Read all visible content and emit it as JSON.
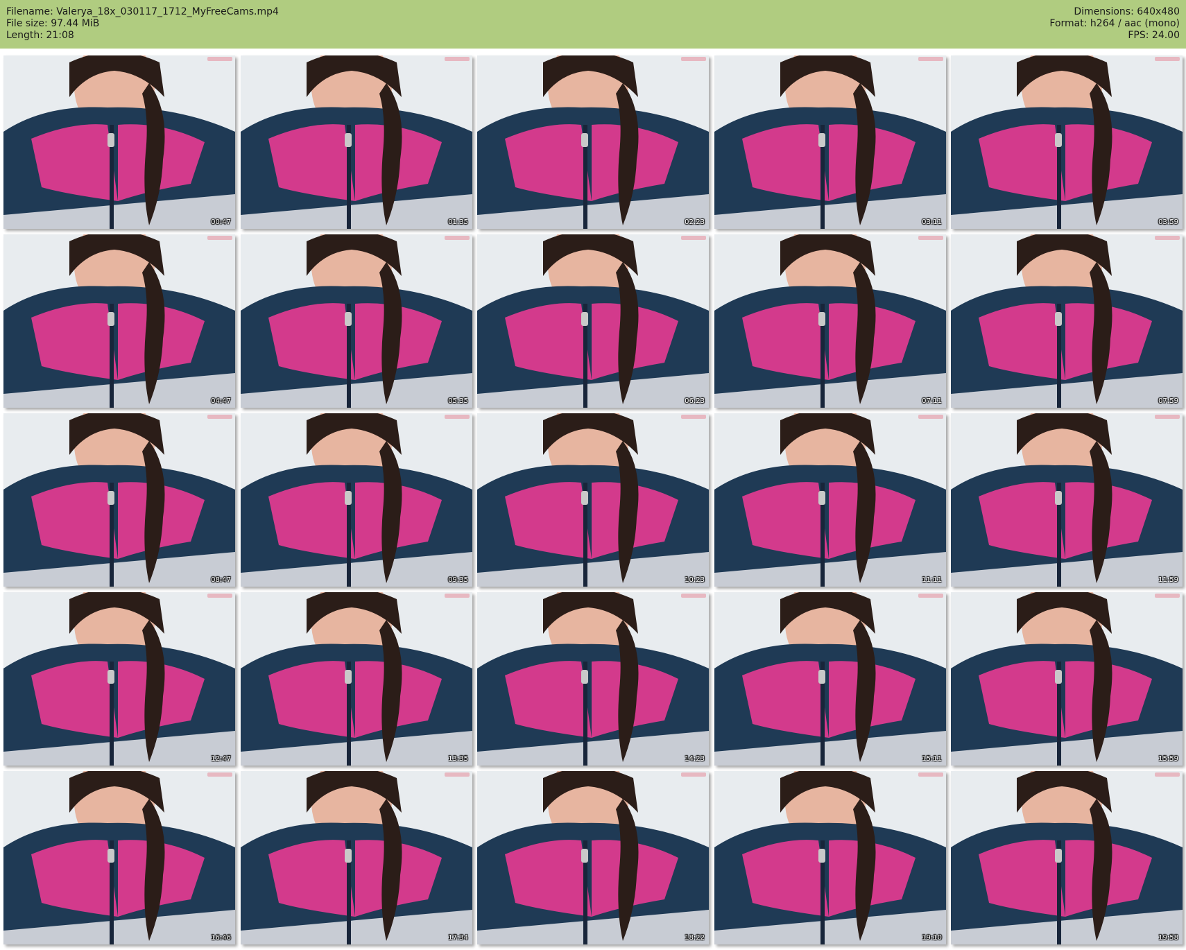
{
  "header": {
    "filename": "Filename: Valerya_18x_030117_1712_MyFreeCams.mp4",
    "filesize": "File size: 97.44 MiB",
    "length": "Length: 21:08",
    "dimensions": "Dimensions: 640x480",
    "format": "Format: h264 / aac (mono)",
    "fps": "FPS: 24.00"
  },
  "thumbnails": [
    "00:47",
    "01:35",
    "02:23",
    "03:11",
    "03:59",
    "04:47",
    "05:35",
    "06:23",
    "07:11",
    "07:59",
    "08:47",
    "09:35",
    "10:23",
    "11:11",
    "11:59",
    "12:47",
    "13:35",
    "14:23",
    "15:11",
    "15:59",
    "16:46",
    "17:34",
    "18:22",
    "19:10",
    "19:58"
  ],
  "colors": {
    "header_bg": "#b0cc80",
    "jacket_pink": "#d33a8c",
    "jacket_navy": "#1f3a55"
  }
}
